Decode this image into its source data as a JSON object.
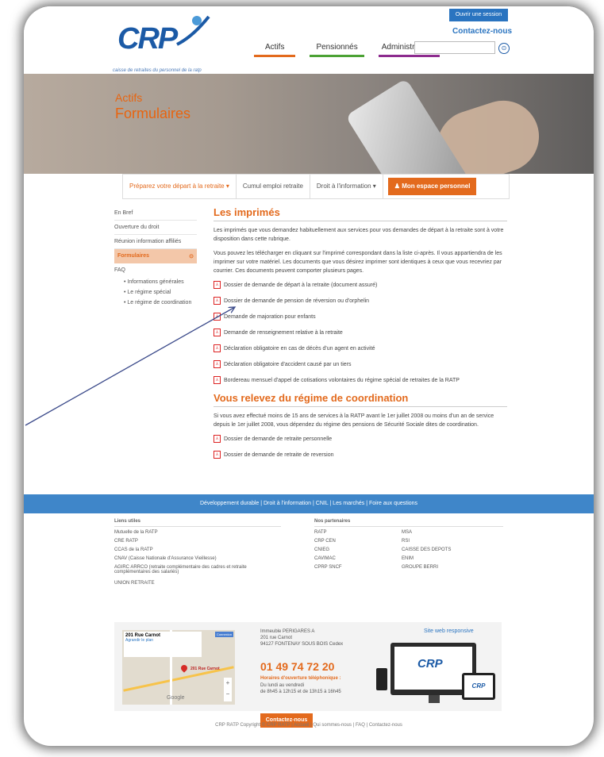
{
  "header": {
    "logo_text": "CRP",
    "tagline": "caisse de retraites du personnel de la ratp",
    "nav": [
      "Actifs",
      "Pensionnés",
      "Administrateurs"
    ],
    "session_button": "Ouvrir une session",
    "contact_link": "Contactez-nous",
    "search_icon_glyph": "⊙"
  },
  "hero": {
    "section": "Actifs",
    "title": "Formulaires"
  },
  "subnav": {
    "items": [
      "Préparez votre départ à la retraite ▾",
      "Cumul emploi retraite",
      "Droit à l'information ▾"
    ],
    "espace": "♟ Mon espace personnel"
  },
  "sidebar": {
    "items": [
      "En Bref",
      "Ouverture du droit",
      "Réunion information affiliés"
    ],
    "active": "Formulaires",
    "active_icon": "⊙",
    "faq": "FAQ",
    "faq_items": [
      "Informations générales",
      "Le régime spécial",
      "Le régime de coordination"
    ]
  },
  "main": {
    "title1": "Les imprimés",
    "intro1": "Les imprimés que vous demandez habituellement aux services pour vos demandes de départ à la retraite sont à votre disposition dans cette rubrique.",
    "intro2": "Vous pouvez les télécharger en cliquant sur l'imprimé correspondant dans la liste ci-après. Il vous appartiendra de les imprimer sur votre matériel. Les documents que vous désirez imprimer sont identiques à ceux que vous recevriez par courrier. Ces documents peuvent comporter plusieurs pages.",
    "docs": [
      "Dossier de demande de départ à la retraite (document assuré)",
      "Dossier de demande de pension de réversion ou d'orphelin",
      "Demande de majoration pour enfants",
      "Demande de renseignement relative à la retraite",
      "Déclaration obligatoire en cas de décès d'un agent en activité",
      "Déclaration obligatoire d'accident causé par un tiers",
      "Bordereau mensuel d'appel de cotisations volontaires du régime spécial de retraites de la RATP"
    ],
    "title2": "Vous relevez du régime de coordination",
    "intro3": "Si vous avez effectué moins de 15 ans de services à la RATP avant le 1er juillet 2008 ou moins d'un an de service depuis le 1er juillet 2008, vous dépendez du régime des pensions de Sécurité Sociale dites de coordination.",
    "docs2": [
      "Dossier de demande de retraite personnelle",
      "Dossier de demande de retraite de reversion"
    ]
  },
  "footer_bar": "Développement durable  |  Droit à l'information  |  CNIL  |  Les marchés  |  Foire aux questions",
  "links": {
    "utiles_title": "Liens utiles",
    "utiles": [
      "Mutuelle de la RATP",
      "CRE RATP",
      "CCAS de la RATP",
      "CNAV (Caisse Nationale d'Assurance Vieillesse)",
      "AGIRC ARRCO (retraite complémentaire des cadres et retraite complémentaires des salariés)",
      "UNION RETRAITE"
    ],
    "partenaires_title": "Nos partenaires",
    "partenaires_a": [
      "RATP",
      "CRP CEN",
      "CNIEG",
      "CAVIMAC",
      "CPRP SNCF"
    ],
    "partenaires_b": [
      "MSA",
      "RSI",
      "CAISSE DES DEPOTS",
      "ENIM",
      "GROUPE BERRI"
    ]
  },
  "contact_box": {
    "map_card_title": "201 Rue Carnot",
    "map_card_link": "Agrandir le plan",
    "map_connect": "Connexion",
    "map_pin_label": "201 Rue Carnot",
    "map_google": "Google",
    "address": [
      "Immeuble PERIGARES A",
      "201 rue Carnot",
      "94127 FONTENAY SOUS BOIS Cedex"
    ],
    "phone": "01 49 74 72 20",
    "hours_title": "Horaires d'ouverture téléphonique :",
    "hours": [
      "Du lundi au vendredi",
      "de 8h45 à 12h15 et de 13h15 à 16h45"
    ],
    "contact_button": "Contactez-nous",
    "responsive_title": "Site web responsive",
    "devices_logo": "CRP"
  },
  "copyright": "CRP RATP Copyright © CRP RATP | Accueil | Qui sommes-nous | FAQ | Contactez-nous",
  "colors": {
    "accent": "#e36a1d",
    "brand_blue": "#1b5aa6",
    "footer_blue": "#3f86c9"
  }
}
